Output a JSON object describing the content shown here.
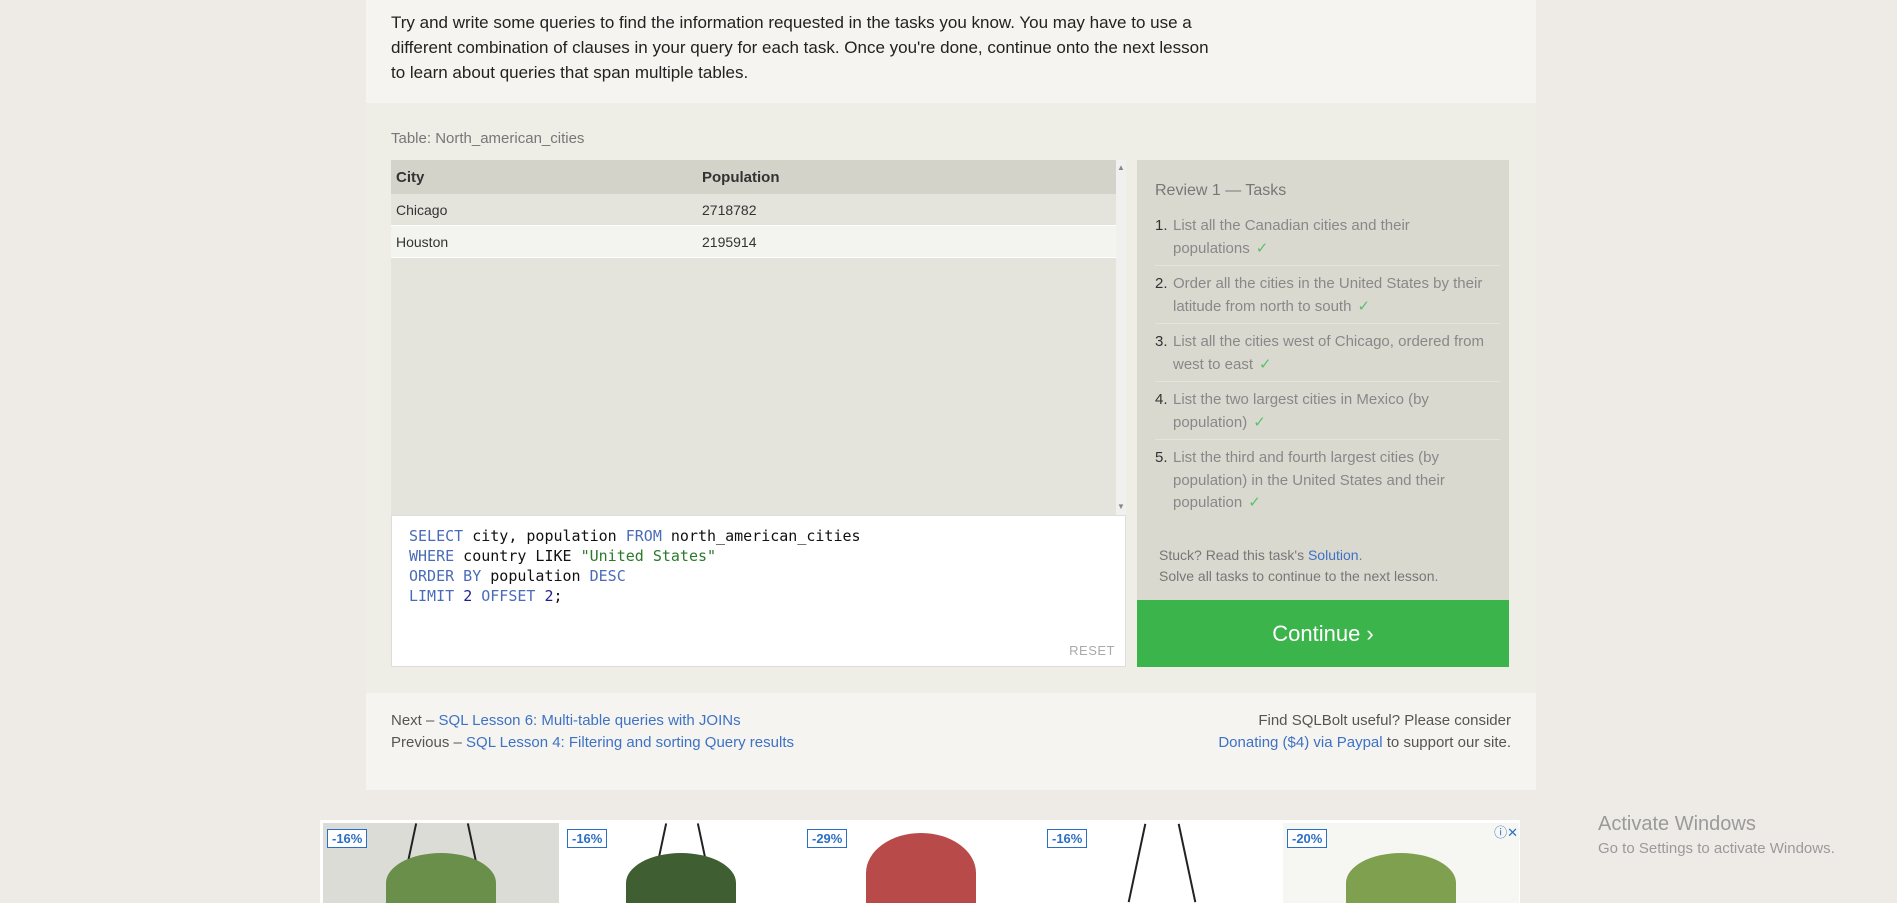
{
  "intro": {
    "text": "Try and write some queries to find the information requested in the tasks you know. You may have to use a different combination of clauses in your query for each task. Once you're done, continue onto the next lesson to learn about queries that span multiple tables."
  },
  "table_title": "Table: North_american_cities",
  "results": {
    "columns": [
      "City",
      "Population"
    ],
    "rows": [
      [
        "Chicago",
        "2718782"
      ],
      [
        "Houston",
        "2195914"
      ]
    ]
  },
  "editor": {
    "line1": {
      "k1": "SELECT",
      "t1": " city, population ",
      "k2": "FROM",
      "t2": " north_american_cities"
    },
    "line2": {
      "k1": "WHERE",
      "t1": " country LIKE ",
      "s1": "\"United States\""
    },
    "line3": {
      "k1": "ORDER BY",
      "t1": " population ",
      "k2": "DESC"
    },
    "line4": {
      "k1": "LIMIT",
      "n1": "2",
      "k2": "OFFSET",
      "n2": "2",
      "t1": ";"
    },
    "reset_label": "RESET"
  },
  "tasks": {
    "title": "Review 1 — Tasks",
    "items": [
      {
        "num": "1.",
        "text": "List all the Canadian cities and their populations",
        "check": "✓"
      },
      {
        "num": "2.",
        "text": "Order all the cities in the United States by their latitude from north to south",
        "check": "✓"
      },
      {
        "num": "3.",
        "text": "List all the cities west of Chicago, ordered from west to east",
        "check": "✓"
      },
      {
        "num": "4.",
        "text": "List the two largest cities in Mexico (by population)",
        "check": "✓"
      },
      {
        "num": "5.",
        "text": "List the third and fourth largest cities (by population) in the United States and their population",
        "check": "✓"
      }
    ],
    "stuck_prefix": "Stuck? Read this task's ",
    "solution_link": "Solution",
    "stuck_suffix": ".",
    "solve_all": "Solve all tasks to continue to the next lesson."
  },
  "continue_label": "Continue ›",
  "footer": {
    "next_prefix": "Next – ",
    "next_link": "SQL Lesson 6: Multi-table queries with JOINs",
    "prev_prefix": "Previous – ",
    "prev_link": "SQL Lesson 4: Filtering and sorting Query results",
    "useful_text": "Find SQLBolt useful? Please consider",
    "donate_link": "Donating ($4) via Paypal",
    "donate_suffix": " to support our site."
  },
  "ads": {
    "badges": [
      "-16%",
      "-16%",
      "-29%",
      "-16%",
      "-20%"
    ],
    "info_icon": "ⓘ✕"
  },
  "activate": {
    "title": "Activate Windows",
    "subtitle": "Go to Settings to activate Windows."
  }
}
